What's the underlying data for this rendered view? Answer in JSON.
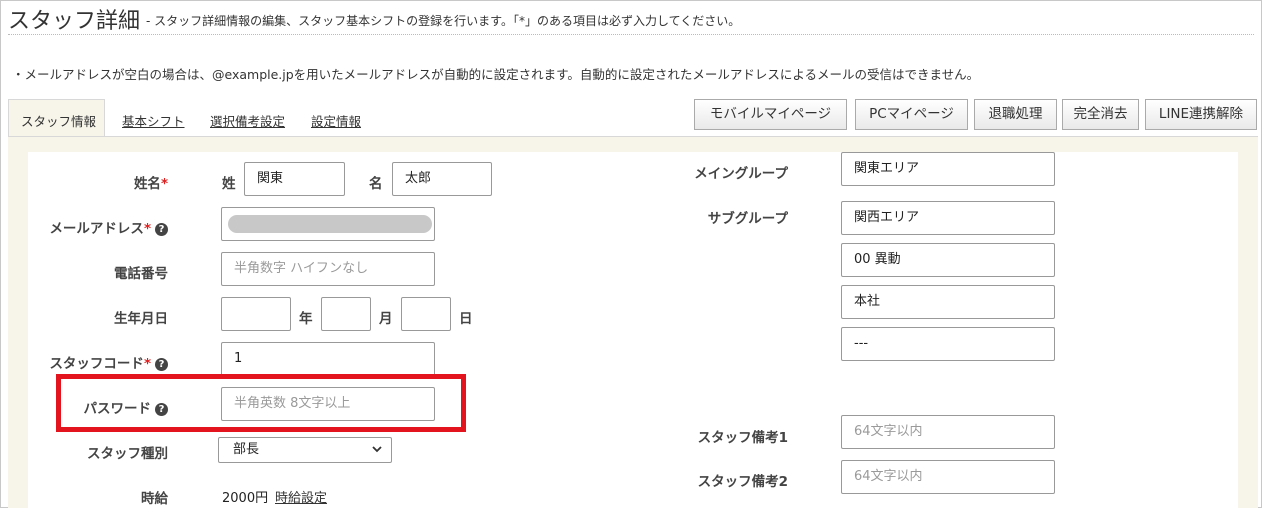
{
  "header": {
    "title": "スタッフ詳細",
    "subtitle": "- スタッフ詳細情報の編集、スタッフ基本シフトの登録を行います。「*」のある項目は必ず入力してください。",
    "notice": "・メールアドレスが空白の場合は、@example.jpを用いたメールアドレスが自動的に設定されます。自動的に設定されたメールアドレスによるメールの受信はできません。"
  },
  "tabs": [
    {
      "label": "スタッフ情報",
      "active": true
    },
    {
      "label": "基本シフト"
    },
    {
      "label": "選択備考設定"
    },
    {
      "label": "設定情報"
    }
  ],
  "toolbar": {
    "mobile_mypage": "モバイルマイページ",
    "pc_mypage": "PCマイページ",
    "retire": "退職処理",
    "delete": "完全消去",
    "line_unlink": "LINE連携解除"
  },
  "form": {
    "required_mark": "*",
    "help_mark": "?",
    "name": {
      "label": "姓名",
      "last_label": "姓",
      "last_value": "関東",
      "first_label": "名",
      "first_value": "太郎"
    },
    "email": {
      "label": "メールアドレス"
    },
    "phone": {
      "label": "電話番号",
      "placeholder": "半角数字 ハイフンなし"
    },
    "birthday": {
      "label": "生年月日",
      "year_label": "年",
      "month_label": "月",
      "day_label": "日"
    },
    "staff_code": {
      "label": "スタッフコード",
      "value": "1"
    },
    "password": {
      "label": "パスワード",
      "placeholder": "半角英数 8文字以上"
    },
    "staff_type": {
      "label": "スタッフ種別",
      "value": "部長"
    },
    "wage": {
      "label": "時給",
      "value": "2000円",
      "link": "時給設定"
    },
    "main_group": {
      "label": "メイングループ",
      "value": "関東エリア"
    },
    "sub_group": {
      "label": "サブグループ",
      "values": [
        "関西エリア",
        "00 異動",
        "本社",
        "---"
      ]
    },
    "note1": {
      "label": "スタッフ備考1",
      "placeholder": "64文字以内"
    },
    "note2": {
      "label": "スタッフ備考2",
      "placeholder": "64文字以内"
    }
  },
  "colors": {
    "highlight": "#e3141e",
    "panel": "#f7f5ea",
    "required": "#e02020"
  }
}
